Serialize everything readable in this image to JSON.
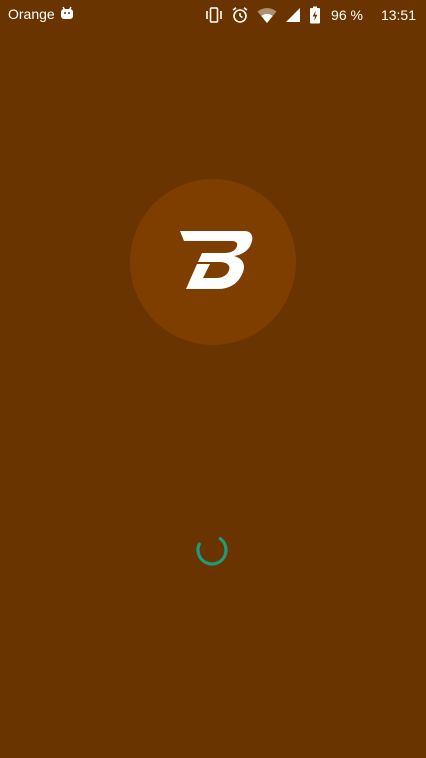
{
  "status_bar": {
    "carrier": "Orange",
    "battery_percent": "96 %",
    "time": "13:51",
    "icons": [
      "android-notification-icon",
      "vibrate-icon",
      "alarm-icon",
      "wifi-icon",
      "cell-signal-icon",
      "battery-charging-icon"
    ]
  },
  "splash": {
    "logo_letter": "B",
    "background_color": "#6a3400",
    "circle_color": "#7e3e00",
    "spinner_color": "#1f9a7a"
  }
}
